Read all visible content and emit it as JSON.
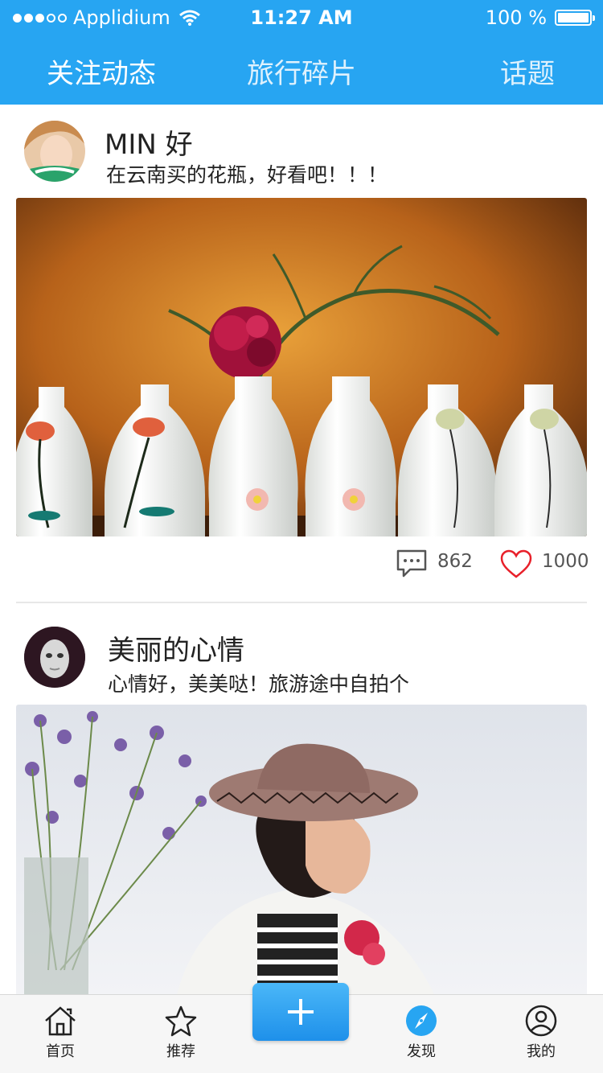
{
  "status_bar": {
    "carrier": "Applidium",
    "time": "11:27 AM",
    "battery": "100 %"
  },
  "top_tabs": [
    "关注动态",
    "旅行碎片",
    "话题"
  ],
  "posts": [
    {
      "user": "MIN 好",
      "text": "在云南买的花瓶，好看吧！！！",
      "comments": "862",
      "likes": "1000"
    },
    {
      "user": "美丽的心情",
      "text": "心情好，美美哒！旅游途中自拍个"
    }
  ],
  "tab_bar": {
    "home": "首页",
    "recommend": "推荐",
    "discover": "发现",
    "me": "我的"
  },
  "colors": {
    "brand": "#27a5f2",
    "like": "#e8202a"
  },
  "icons": [
    "wifi-icon",
    "battery-icon",
    "comment-icon",
    "heart-icon",
    "home-icon",
    "star-icon",
    "plus-icon",
    "compass-icon",
    "profile-icon"
  ]
}
